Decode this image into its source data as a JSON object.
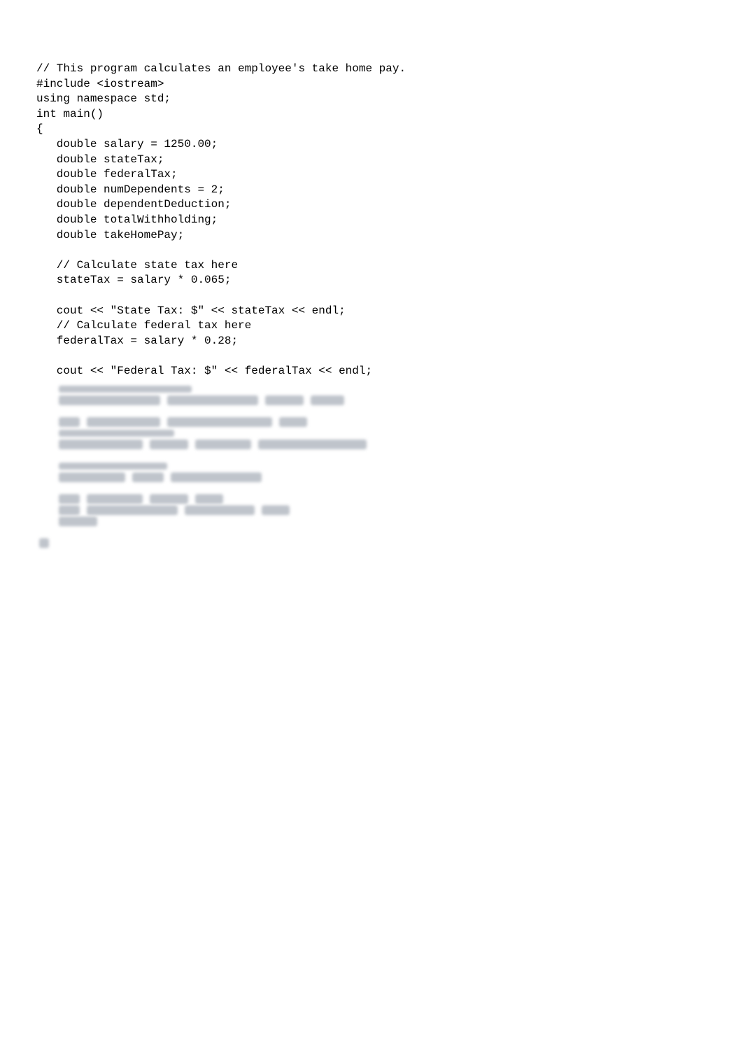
{
  "code": {
    "line1": "// This program calculates an employee's take home pay.",
    "line2": "#include <iostream>",
    "line3": "using namespace std;",
    "line4": "int main()",
    "line5": "{",
    "line6": "   double salary = 1250.00;",
    "line7": "   double stateTax;",
    "line8": "   double federalTax;",
    "line9": "   double numDependents = 2;",
    "line10": "   double dependentDeduction;",
    "line11": "   double totalWithholding;",
    "line12": "   double takeHomePay;",
    "line13": "",
    "line14": "   // Calculate state tax here",
    "line15": "   stateTax = salary * 0.065;",
    "line16": "",
    "line17": "   cout << \"State Tax: $\" << stateTax << endl;",
    "line18": "   // Calculate federal tax here",
    "line19": "   federalTax = salary * 0.28;",
    "line20": "",
    "line21": "   cout << \"Federal Tax: $\" << federalTax << endl;"
  }
}
